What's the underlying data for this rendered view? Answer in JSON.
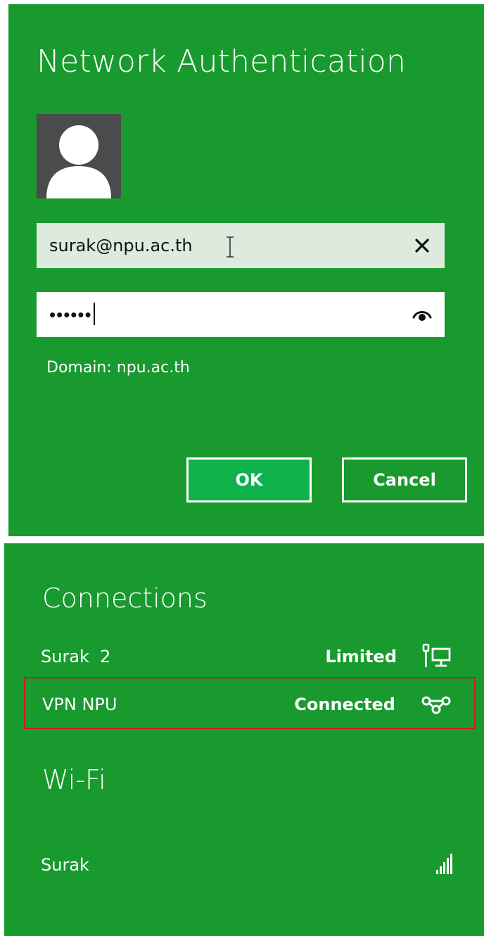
{
  "auth": {
    "title": "Network Authentication",
    "username": {
      "value": "surak@npu.ac.th"
    },
    "password": {
      "masked": "••••••"
    },
    "domain_label": "Domain: npu.ac.th",
    "ok_label": "OK",
    "cancel_label": "Cancel"
  },
  "connections": {
    "heading": "Connections",
    "items": [
      {
        "name": "Surak  2",
        "status": "Limited",
        "icon": "wired-network-icon"
      },
      {
        "name": "VPN NPU",
        "status": "Connected",
        "icon": "vpn-icon",
        "highlighted": true
      }
    ]
  },
  "wifi": {
    "heading": "Wi-Fi",
    "items": [
      {
        "name": "Surak",
        "icon": "wifi-signal-icon",
        "signal_bars": 5
      }
    ]
  },
  "colors": {
    "panel_green": "#189a2e",
    "ok_button_green": "#0fb14a",
    "username_field_bg": "#dcebde",
    "highlight_border": "#d11c1c",
    "avatar_bg": "#4b4b4b"
  }
}
